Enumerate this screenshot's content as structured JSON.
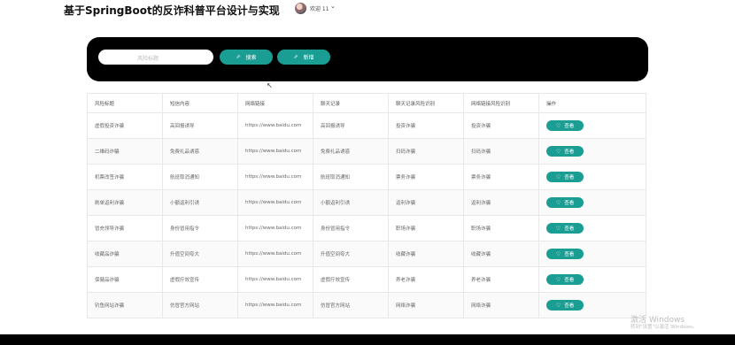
{
  "header": {
    "title": "基于SpringBoot的反诈科普平台设计与实现",
    "welcome": "欢迎 11",
    "chevron": "⌄"
  },
  "search": {
    "label": "风险标题:",
    "placeholder": "风险标题",
    "search_button": "搜索",
    "add_button": "新增"
  },
  "table": {
    "columns": [
      "风险标题",
      "短信内容",
      "网络链接",
      "聊天记录",
      "聊天记录风险识别",
      "网络链接风险识别",
      "操作"
    ],
    "rows": [
      [
        "虚假投资诈骗",
        "高回报诱导",
        "https://www.baidu.com",
        "高回报诱导",
        "投资诈骗",
        "投资诈骗"
      ],
      [
        "二维码诈骗",
        "免费礼品诱惑",
        "https://www.baidu.com",
        "免费礼品诱惑",
        "扫码诈骗",
        "扫码诈骗"
      ],
      [
        "机票改签诈骗",
        "航班取消通知",
        "https://www.baidu.com",
        "航班取消通知",
        "票务诈骗",
        "票务诈骗"
      ],
      [
        "刷单返利诈骗",
        "小额返利引诱",
        "https://www.baidu.com",
        "小额返利引诱",
        "返利诈骗",
        "返利诈骗"
      ],
      [
        "冒充领导诈骗",
        "身份冒用指令",
        "https://www.baidu.com",
        "身份冒用指令",
        "职场诈骗",
        "职场诈骗"
      ],
      [
        "收藏品诈骗",
        "升值空间夸大",
        "https://www.baidu.com",
        "升值空间夸大",
        "收藏诈骗",
        "收藏诈骗"
      ],
      [
        "保健品诈骗",
        "虚假疗效宣传",
        "https://www.baidu.com",
        "虚假疗效宣传",
        "养老诈骗",
        "养老诈骗"
      ],
      [
        "钓鱼网站诈骗",
        "仿冒官方网站",
        "https://www.baidu.com",
        "仿冒官方网站",
        "网络诈骗",
        "网络诈骗"
      ]
    ],
    "view_label": "查看"
  },
  "watermark": {
    "line1": "激活 Windows",
    "line2": "转到\"设置\"以激活 Windows。"
  },
  "colors": {
    "accent": "#1a9e94",
    "panel": "#000000"
  }
}
